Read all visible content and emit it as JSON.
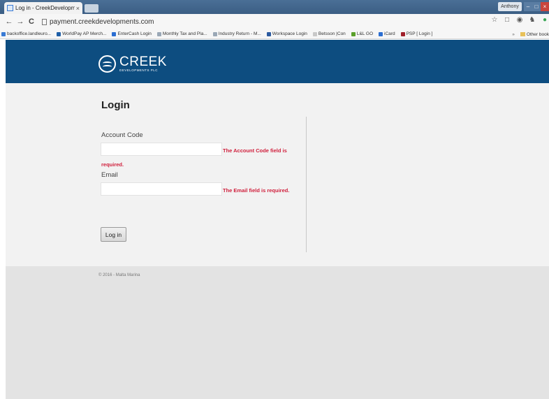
{
  "browser": {
    "tab_title": "Log in - CreekDevelopme",
    "tab_close": "×",
    "profile_name": "Anthony",
    "window_buttons": {
      "minimize": "–",
      "maximize": "□",
      "close": "×"
    },
    "nav": {
      "back": "←",
      "forward": "→",
      "reload": "C"
    },
    "url": "payment.creekdevelopments.com",
    "toolbar_icons": {
      "star": "☆",
      "cast": "□",
      "ext1": "◉",
      "ext2": "♞",
      "ext3": "●"
    },
    "bookmarks": [
      {
        "label": "backoffice.landleuro...",
        "color": "#3a7bd5"
      },
      {
        "label": "WorldPay AP Merch...",
        "color": "#1f5fa8"
      },
      {
        "label": "EnterCash Login",
        "color": "#2b6ed2"
      },
      {
        "label": "Monthly Tax and Pla...",
        "color": "#9aa8b6"
      },
      {
        "label": "Industry Return - M...",
        "color": "#9aa8b6"
      },
      {
        "label": "Workspace Login",
        "color": "#2b5aa0"
      },
      {
        "label": "Betsson |Con",
        "color": "#c8c8c8"
      },
      {
        "label": "L&L GO",
        "color": "#5aa02b"
      },
      {
        "label": "iCard",
        "color": "#2b6ed2"
      },
      {
        "label": "PSP [ Login ]",
        "color": "#a0202b"
      }
    ],
    "bookmarks_overflow": "»",
    "other_bookmarks": "Other book"
  },
  "header": {
    "logo_name": "CREEK",
    "logo_sub": "DEVELOPMENTS PLC"
  },
  "form": {
    "title": "Login",
    "account_label": "Account Code",
    "account_value": "",
    "account_error_line1": "The Account Code field is",
    "account_error_line2": "required.",
    "email_label": "Email",
    "email_value": "",
    "email_error": "The Email field is required.",
    "submit_label": "Log in"
  },
  "footer": {
    "copyright": "© 2016 - Malta Marina"
  }
}
